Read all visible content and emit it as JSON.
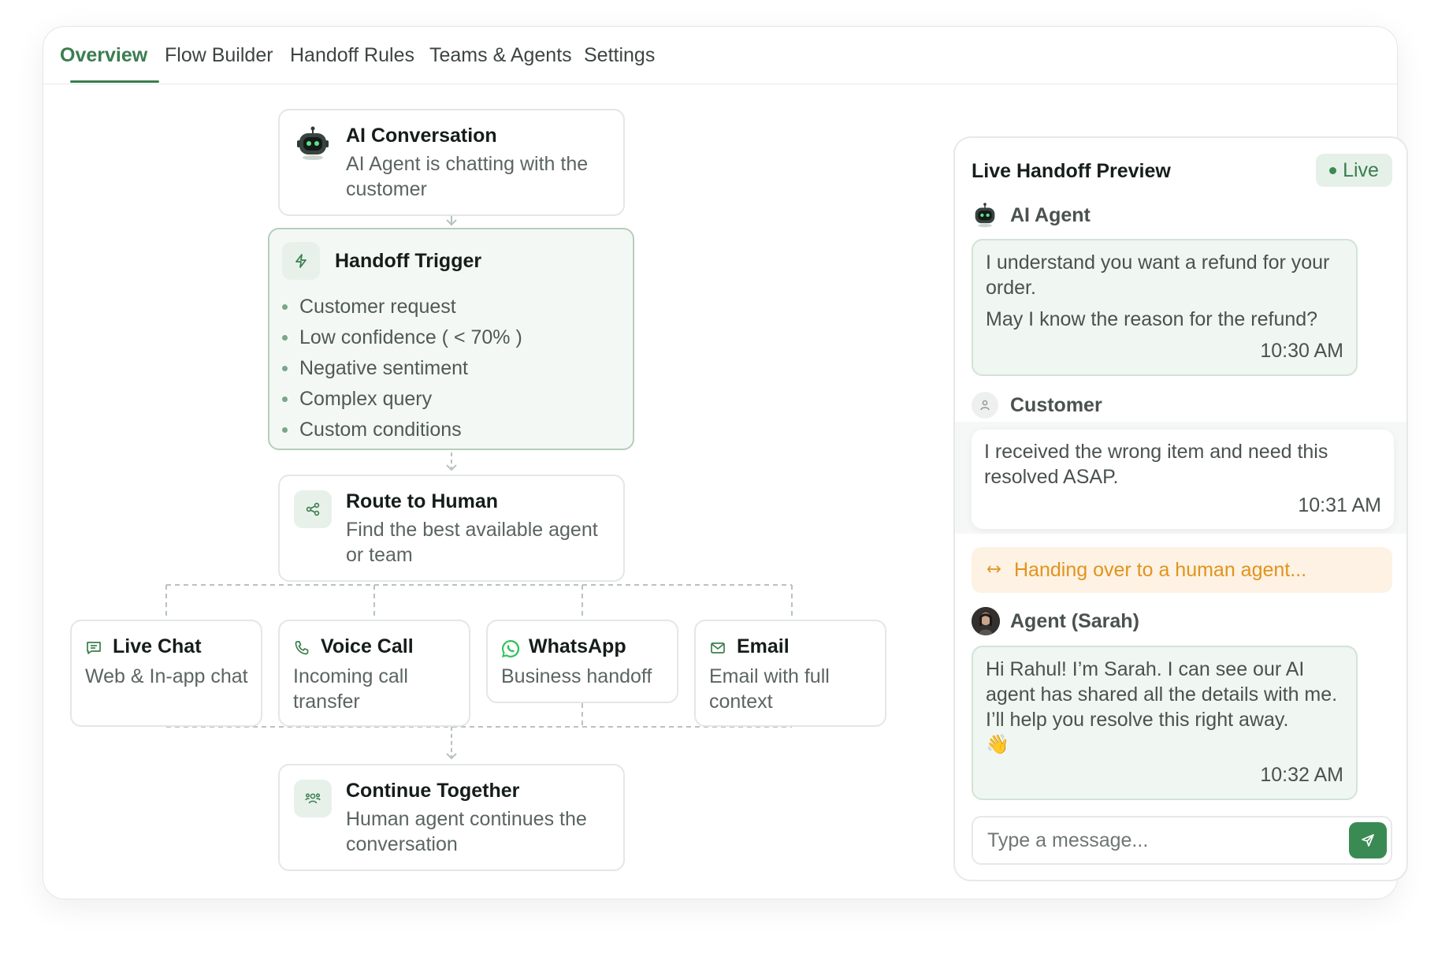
{
  "tabs": [
    {
      "label": "Overview",
      "active": true
    },
    {
      "label": "Flow Builder"
    },
    {
      "label": "Handoff Rules"
    },
    {
      "label": "Teams & Agents"
    },
    {
      "label": "Settings"
    }
  ],
  "flow": {
    "ai_conversation": {
      "title": "AI Conversation",
      "desc": "AI Agent is chatting with the customer",
      "icon": "robot-icon"
    },
    "handoff_trigger": {
      "title": "Handoff Trigger",
      "icon": "lightning-icon",
      "items": [
        "Customer request",
        "Low confidence ( < 70% )",
        "Negative sentiment",
        "Complex query",
        "Custom conditions"
      ]
    },
    "route_to_human": {
      "title": "Route to Human",
      "desc": "Find the best available agent or team",
      "icon": "share-nodes-icon"
    },
    "channels": [
      {
        "title": "Live Chat",
        "desc": "Web & In-app chat",
        "icon": "chat-icon"
      },
      {
        "title": "Voice Call",
        "desc": "Incoming call transfer",
        "icon": "phone-icon"
      },
      {
        "title": "WhatsApp",
        "desc": "Business handoff",
        "icon": "whatsapp-icon"
      },
      {
        "title": "Email",
        "desc": "Email with full context",
        "icon": "mail-icon"
      }
    ],
    "continue_together": {
      "title": "Continue Together",
      "desc": "Human agent continues the conversation",
      "icon": "team-icon"
    }
  },
  "preview": {
    "title": "Live Handoff Preview",
    "status": "Live",
    "ai": {
      "speaker": "AI Agent",
      "line1": "I understand you want a refund for your order.",
      "line2": "May I know the reason for the refund?",
      "time": "10:30 AM"
    },
    "customer": {
      "speaker": "Customer",
      "text": "I received the wrong item and need this resolved ASAP.",
      "time": "10:31 AM"
    },
    "handover": "Handing over to a human agent...",
    "agent": {
      "speaker": "Agent (Sarah)",
      "text": "Hi Rahul! I’m Sarah. I can see our AI agent has shared all the details with me. I’ll help you resolve this right away.",
      "emoji": "👋",
      "time": "10:32 AM"
    },
    "input_placeholder": "Type a message..."
  },
  "colors": {
    "accent": "#3a7d4f",
    "handover": "#e2931d",
    "live_bg": "#e5f1e8"
  }
}
